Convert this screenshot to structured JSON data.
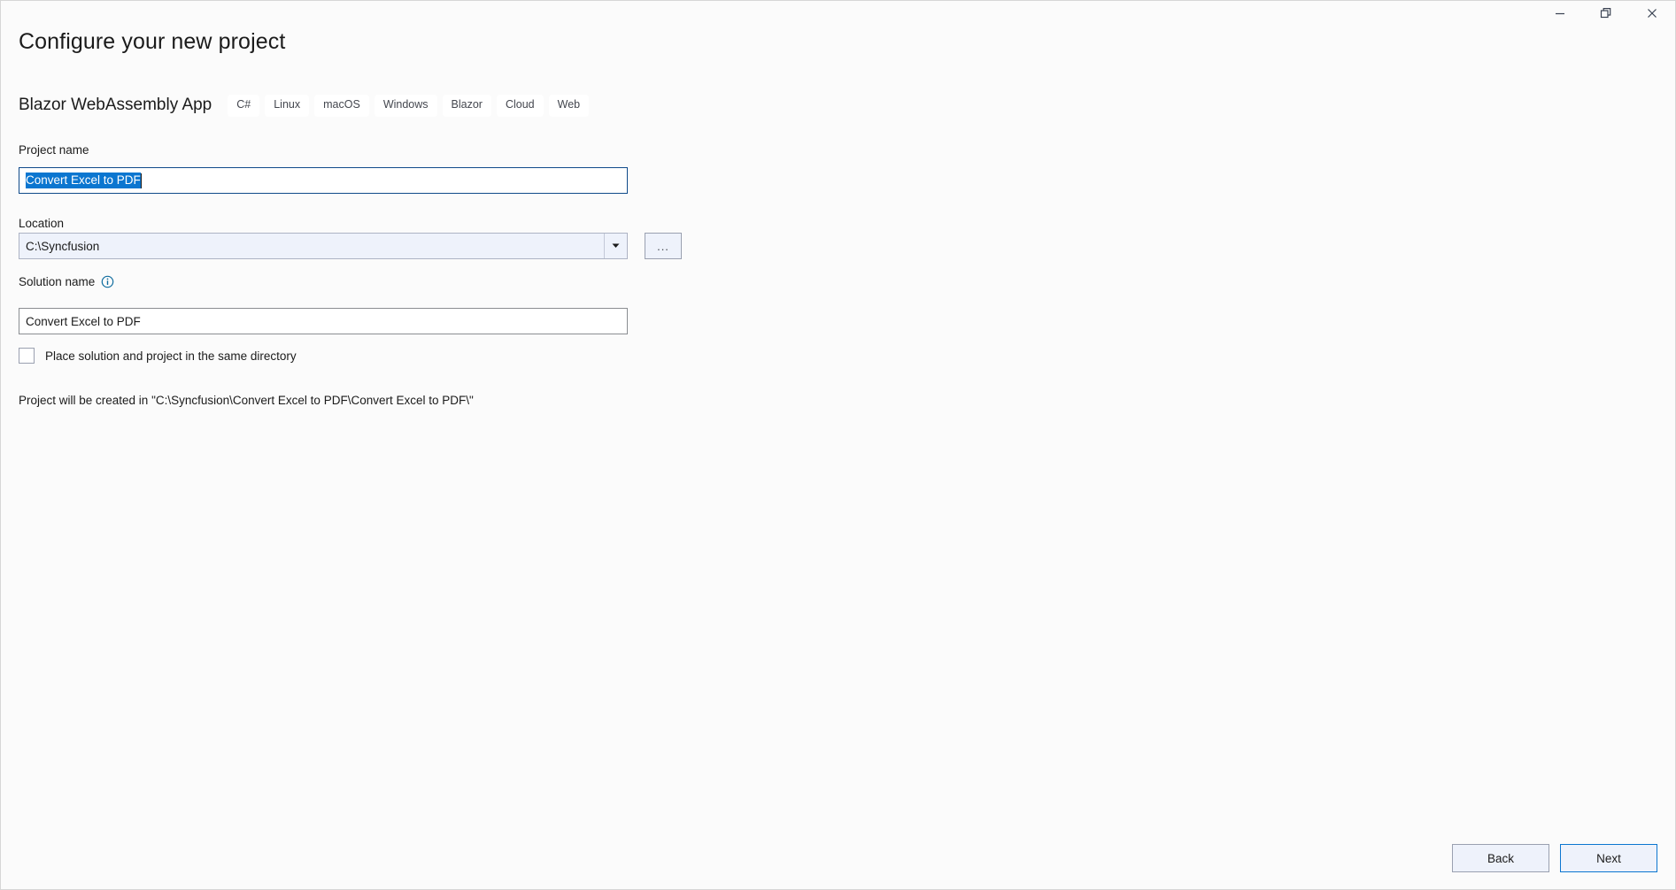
{
  "window": {
    "controls": [
      {
        "name": "minimize",
        "label": "Minimize"
      },
      {
        "name": "restore",
        "label": "Restore"
      },
      {
        "name": "close",
        "label": "Close"
      }
    ]
  },
  "header": {
    "title": "Configure your new project"
  },
  "template": {
    "name": "Blazor WebAssembly App",
    "tags": [
      "C#",
      "Linux",
      "macOS",
      "Windows",
      "Blazor",
      "Cloud",
      "Web"
    ]
  },
  "form": {
    "project_name": {
      "label": "Project name",
      "value": "Convert Excel to PDF",
      "selected": true
    },
    "location": {
      "label": "Location",
      "value": "C:\\Syncfusion",
      "browse_label": "...",
      "dropdown_icon": "chevron-down-icon"
    },
    "solution_name": {
      "label": "Solution name",
      "value": "Convert Excel to PDF",
      "info_icon": "info-circle-icon"
    },
    "same_directory": {
      "label": "Place solution and project in the same directory",
      "checked": false
    },
    "created_path": "Project will be created in \"C:\\Syncfusion\\Convert Excel to PDF\\Convert Excel to PDF\\\""
  },
  "footer": {
    "back_label": "Back",
    "next_label": "Next"
  },
  "colors": {
    "selection": "#0b76d0",
    "accent": "#0b76d0",
    "info": "#0f6c9e",
    "field_border": "#8a8d91"
  }
}
